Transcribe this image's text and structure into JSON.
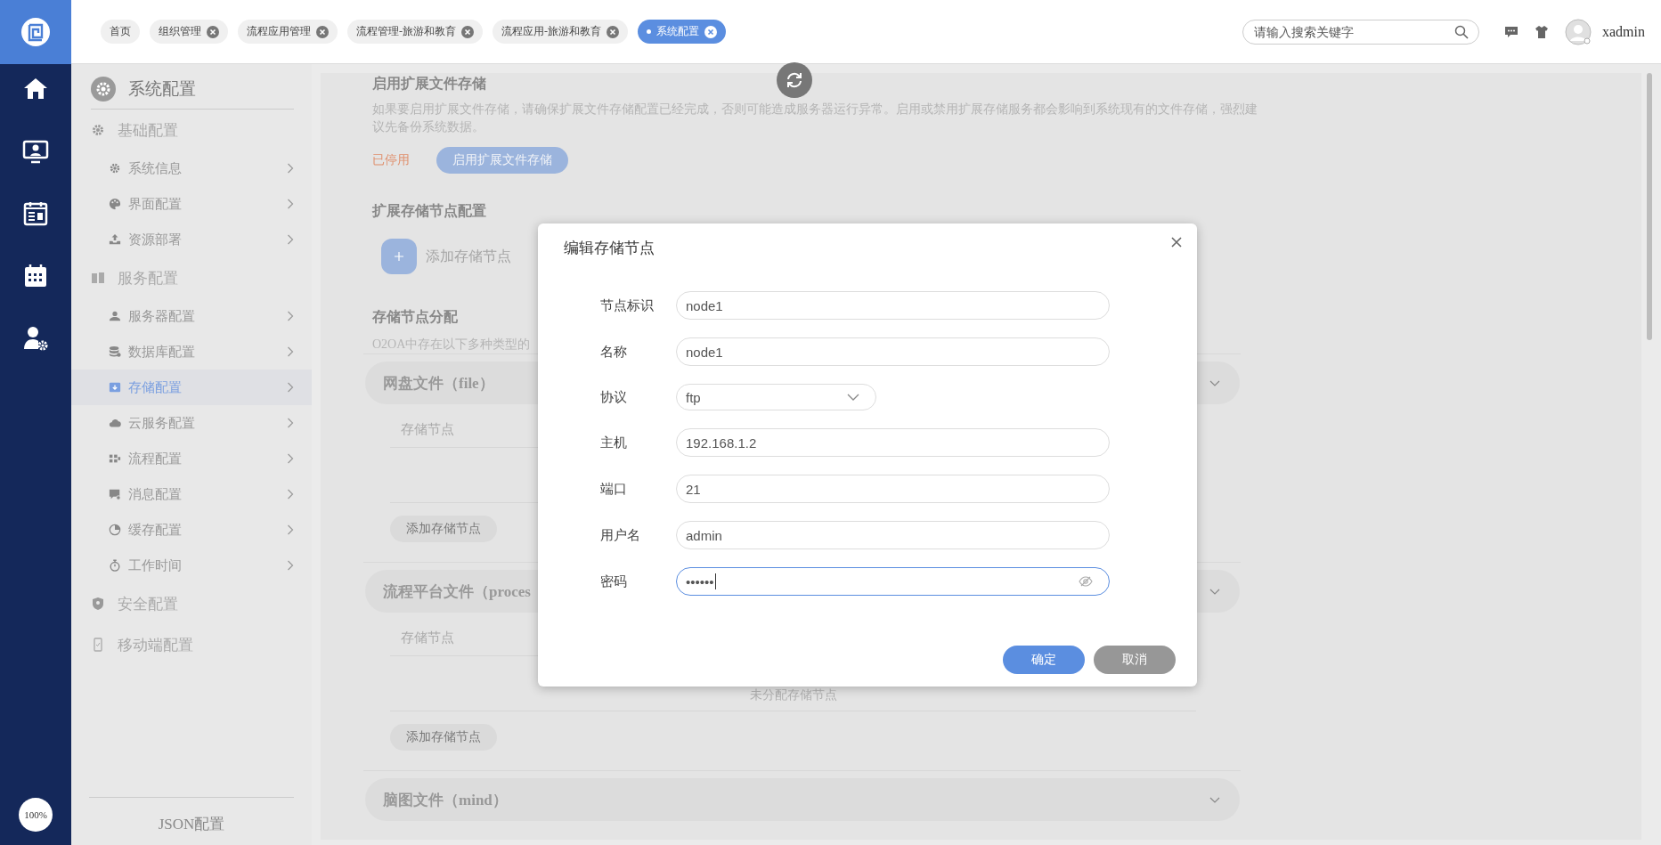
{
  "zoom_level": "100%",
  "tabs": [
    {
      "label": "首页",
      "selected": false,
      "closable": false
    },
    {
      "label": "组织管理",
      "selected": false,
      "closable": true
    },
    {
      "label": "流程应用管理",
      "selected": false,
      "closable": true
    },
    {
      "label": "流程管理-旅游和教育",
      "selected": false,
      "closable": true
    },
    {
      "label": "流程应用-旅游和教育",
      "selected": false,
      "closable": true
    },
    {
      "label": "系统配置",
      "selected": true,
      "closable": true
    }
  ],
  "search": {
    "placeholder": "请输入搜索关键字"
  },
  "user": {
    "name": "xadmin"
  },
  "sidebar": {
    "title": "系统配置",
    "groups": [
      {
        "label": "基础配置",
        "items": [
          {
            "label": "系统信息",
            "selected": false
          },
          {
            "label": "界面配置",
            "selected": false
          },
          {
            "label": "资源部署",
            "selected": false
          }
        ]
      },
      {
        "label": "服务配置",
        "items": [
          {
            "label": "服务器配置",
            "selected": false
          },
          {
            "label": "数据库配置",
            "selected": false
          },
          {
            "label": "存储配置",
            "selected": true
          },
          {
            "label": "云服务配置",
            "selected": false
          },
          {
            "label": "流程配置",
            "selected": false
          },
          {
            "label": "消息配置",
            "selected": false
          },
          {
            "label": "缓存配置",
            "selected": false
          },
          {
            "label": "工作时间",
            "selected": false
          }
        ]
      },
      {
        "label": "安全配置"
      },
      {
        "label": "移动端配置"
      }
    ],
    "footer": "JSON配置"
  },
  "enable_section": {
    "title": "启用扩展文件存储",
    "description": "如果要启用扩展文件存储，请确保扩展文件存储配置已经完成，否则可能造成服务器运行异常。启用或禁用扩展存储服务都会影响到系统现有的文件存储，强烈建议先备份系统数据。",
    "status": "已停用",
    "button": "启用扩展文件存储"
  },
  "node_section": {
    "title": "扩展存储节点配置",
    "add_label": "添加存储节点"
  },
  "assign_section": {
    "title": "存储节点分配",
    "description": "O2OA中存在以下多种类型的",
    "categories": [
      {
        "title": "网盘文件（file）",
        "column": "存储节点",
        "add_button": "添加存储节点"
      },
      {
        "title": "流程平台文件（proces",
        "column": "存储节点",
        "empty_text": "未分配存储节点",
        "add_button": "添加存储节点"
      },
      {
        "title": "脑图文件（mind）"
      }
    ]
  },
  "dialog": {
    "title": "编辑存储节点",
    "fields": [
      {
        "label": "节点标识",
        "kind": "text",
        "value": "node1",
        "focused": false
      },
      {
        "label": "名称",
        "kind": "text",
        "value": "node1",
        "focused": false
      },
      {
        "label": "协议",
        "kind": "select",
        "value": "ftp",
        "focused": false
      },
      {
        "label": "主机",
        "kind": "text",
        "value": "192.168.1.2",
        "focused": false
      },
      {
        "label": "端口",
        "kind": "text",
        "value": "21",
        "focused": false
      },
      {
        "label": "用户名",
        "kind": "text",
        "value": "admin",
        "focused": false
      },
      {
        "label": "密码",
        "kind": "password",
        "value": "••••••",
        "focused": true
      }
    ],
    "buttons": [
      {
        "label": "确定",
        "kind": "primary"
      },
      {
        "label": "取消",
        "kind": "secondary"
      }
    ]
  }
}
